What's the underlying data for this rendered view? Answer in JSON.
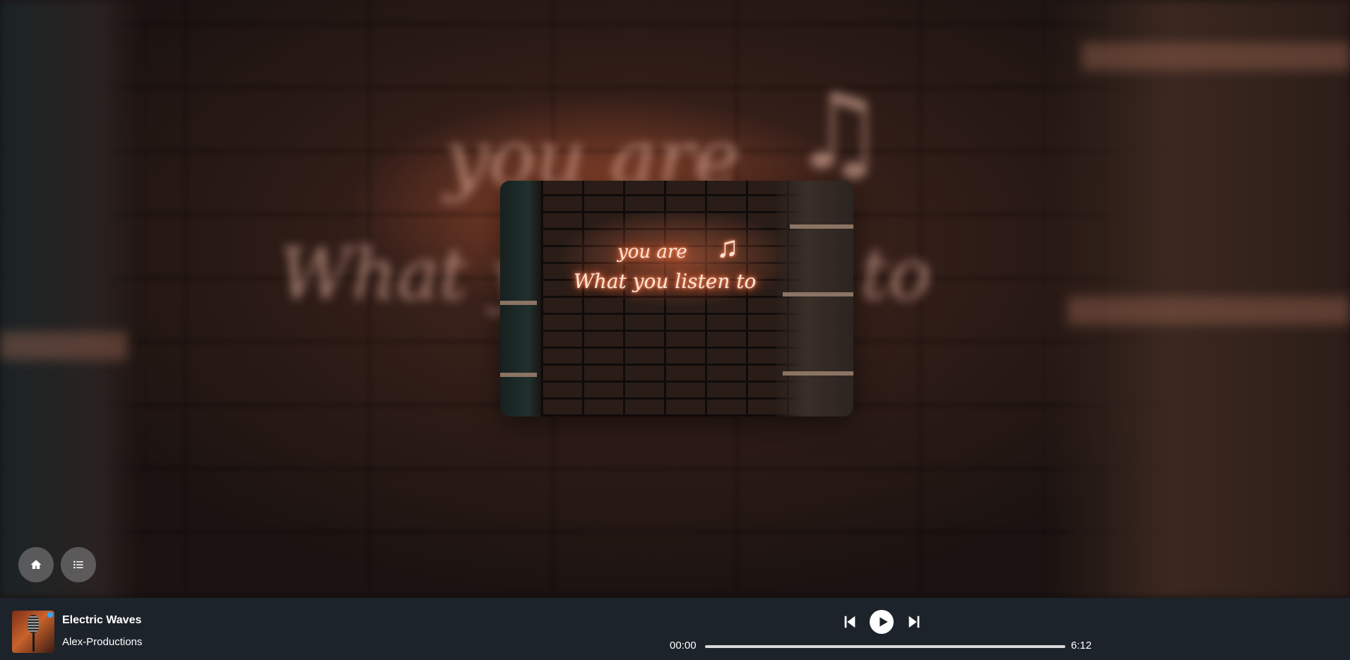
{
  "nav": {
    "home_icon": "home-icon",
    "list_icon": "list-icon"
  },
  "artwork": {
    "line1": "you are",
    "line2": "What you listen to",
    "note": "♫"
  },
  "player": {
    "title": "Electric Waves",
    "artist": "Alex-Productions",
    "current_time": "00:00",
    "duration": "6:12",
    "progress": 0,
    "controls": [
      "previous-icon",
      "play-icon",
      "next-icon"
    ]
  },
  "colors": {
    "player_bg": "#1d232a",
    "fab_bg": "#6e6e6e",
    "neon": "#ff6a3a"
  }
}
